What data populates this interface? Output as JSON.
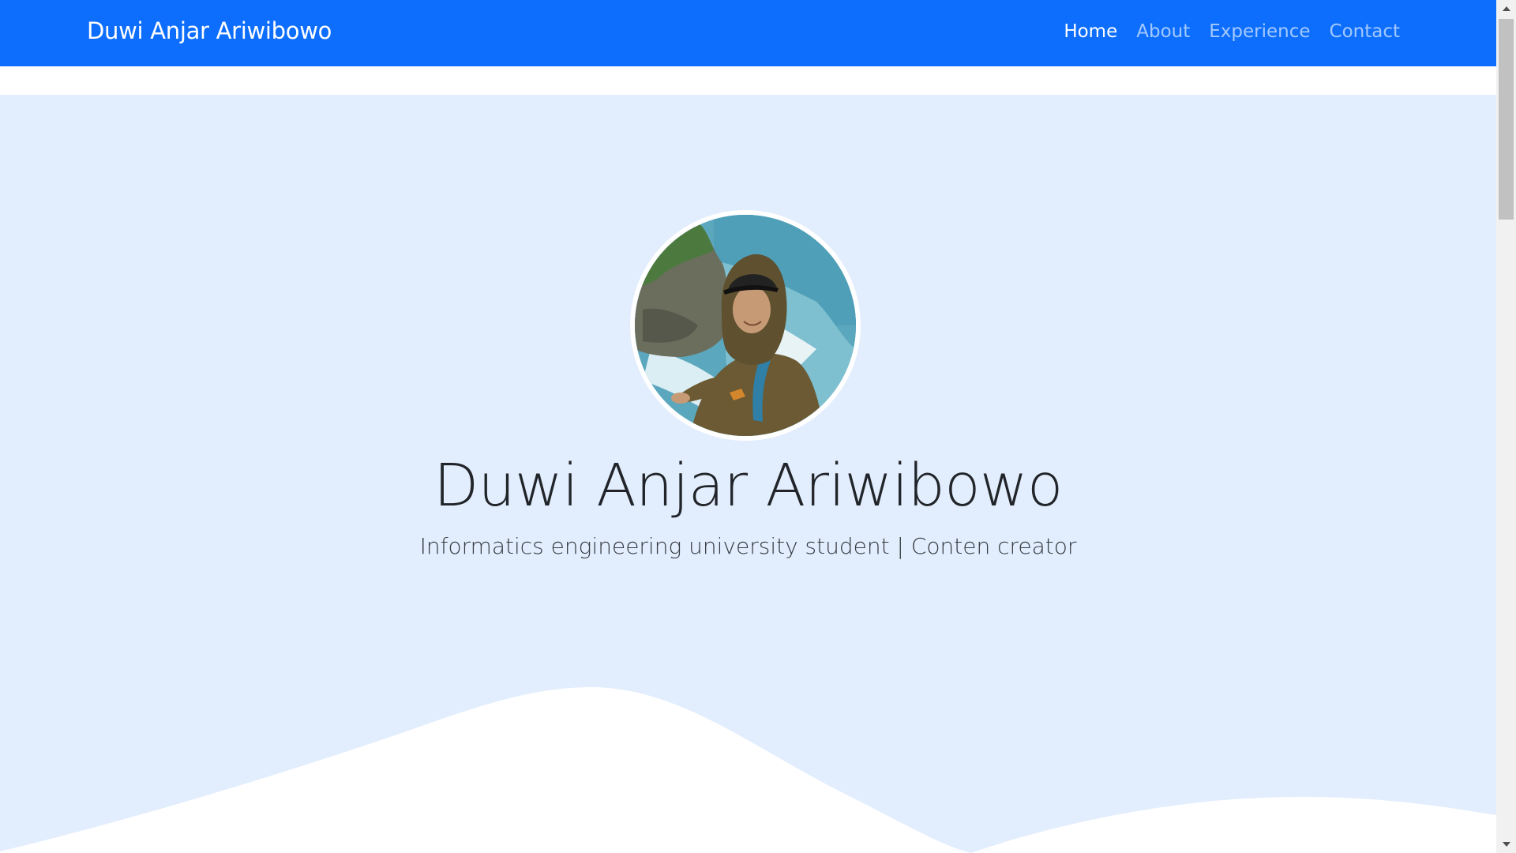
{
  "navbar": {
    "brand": "Duwi Anjar Ariwibowo",
    "links": [
      {
        "label": "Home",
        "active": true
      },
      {
        "label": "About",
        "active": false
      },
      {
        "label": "Experience",
        "active": false
      },
      {
        "label": "Contact",
        "active": false
      }
    ]
  },
  "hero": {
    "name": "Duwi Anjar Ariwibowo",
    "tagline": "Informatics engineering university student | Conten creator",
    "avatar_icon": "profile-photo"
  },
  "colors": {
    "navbar": "#0d6efd",
    "hero_background": "#e2edfd",
    "wave": "#ffffff"
  }
}
